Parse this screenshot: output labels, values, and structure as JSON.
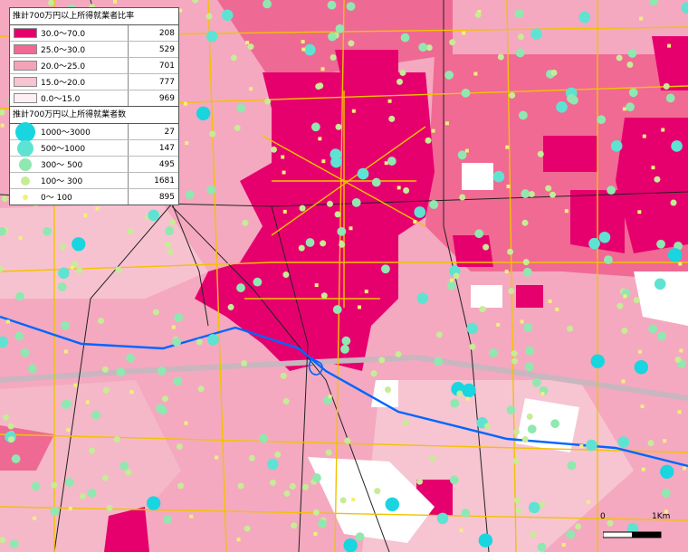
{
  "legend": {
    "ratio": {
      "title": "推計700万円以上所得就業者比率",
      "items": [
        {
          "label": "30.0～70.0",
          "count": "208",
          "color": "#e6006e"
        },
        {
          "label": "25.0～30.0",
          "count": "529",
          "color": "#f06a94"
        },
        {
          "label": "20.0～25.0",
          "count": "701",
          "color": "#f4a3b6"
        },
        {
          "label": "15.0～20.0",
          "count": "777",
          "color": "#f7c4d2"
        },
        {
          "label": "0.0～15.0",
          "count": "969",
          "color": "#fcf0f4"
        }
      ]
    },
    "count": {
      "title": "推計700万円以上所得就業者数",
      "items": [
        {
          "label": "1000～3000",
          "count": "27",
          "color": "#19d5e0",
          "size": 11
        },
        {
          "label": "500～1000",
          "count": "147",
          "color": "#5ee3d2",
          "size": 9
        },
        {
          "label": "300～ 500",
          "count": "495",
          "color": "#8fe8b0",
          "size": 7
        },
        {
          "label": "100～ 300",
          "count": "1681",
          "color": "#c6ec95",
          "size": 5
        },
        {
          "label": "0～ 100",
          "count": "895",
          "color": "#f2f07a",
          "size": 3
        }
      ]
    }
  },
  "scale": {
    "start": "0",
    "end": "1Km"
  }
}
